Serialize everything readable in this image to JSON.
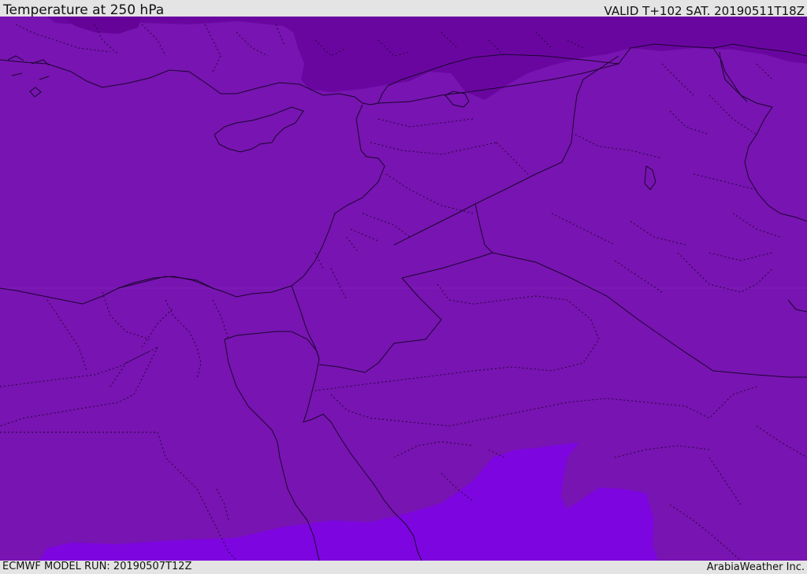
{
  "header": {
    "title": "Temperature at 250 hPa",
    "valid": "VALID T+102 SAT. 20190511T18Z"
  },
  "footer": {
    "model_run": "ECMWF MODEL RUN: 20190507T12Z",
    "credit": "ArabiaWeather Inc."
  },
  "map": {
    "colors": {
      "base": "#7814b1",
      "cold": "#6a06a0",
      "warm": "#7d05df",
      "border": "#1a0530"
    },
    "icons": {
      "coastline": "solid-line",
      "national-border": "solid-line",
      "province-border": "dotted-line"
    }
  }
}
